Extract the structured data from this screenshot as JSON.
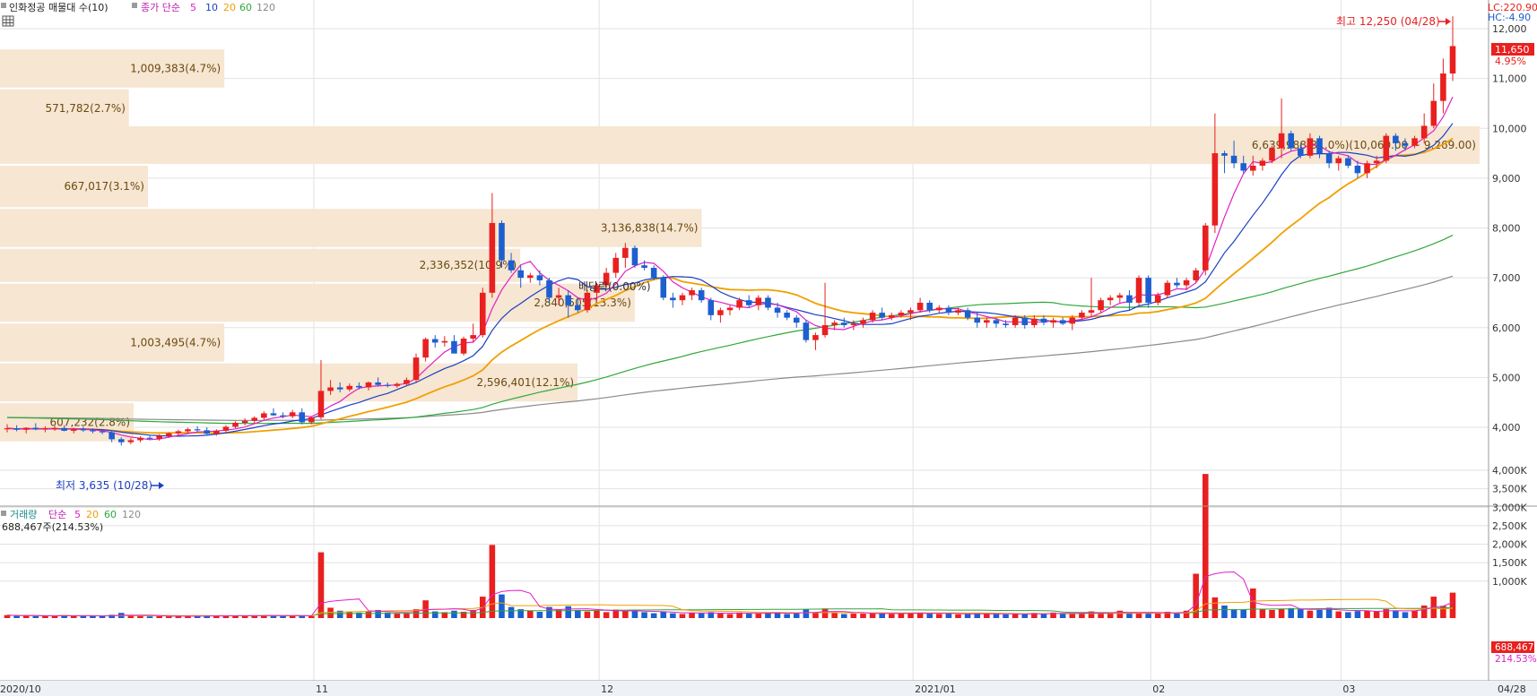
{
  "price_panel": {
    "legend": {
      "title": "인화정공 매물대 수(10)",
      "ma_label": "종가 단순",
      "ma_periods": [
        "5",
        "10",
        "20",
        "60",
        "120"
      ]
    },
    "lc_label": "LC:220.90",
    "hc_label": "HC:-4.90",
    "high_label": "최고 12,250 (04/28)",
    "low_label": "최저 3,635 (10/28)",
    "dividend_label": "배당락(0.00%)",
    "last_price": "11,650",
    "last_change": "4.95%",
    "y_ticks": [
      "12,000",
      "11,000",
      "10,000",
      "9,000",
      "8,000",
      "7,000",
      "6,000",
      "5,000",
      "4,000"
    ]
  },
  "volume_panel": {
    "legend": {
      "title": "거래량",
      "ma_label": "단순",
      "ma_periods": [
        "5",
        "20",
        "60",
        "120"
      ]
    },
    "info": "688,467주(214.53%)",
    "last_volume": "688,467",
    "last_ratio": "214.53%",
    "y_ticks": [
      "4,000K",
      "3,500K",
      "3,000K",
      "2,500K",
      "2,000K",
      "1,500K",
      "1,000K"
    ]
  },
  "x_labels": [
    "2020/10",
    "11",
    "12",
    "2021/01",
    "02",
    "03",
    "04",
    "04/28"
  ],
  "colors": {
    "up": "#e8201f",
    "down": "#1c5fcf",
    "ma5": "#e020c8",
    "ma10": "#1a3fc4",
    "ma20": "#f0a000",
    "ma60": "#2fa83a",
    "ma120": "#8a8a8a",
    "volume_profile": "#f6e6d2",
    "grid": "#e2e2e2"
  },
  "chart_data": {
    "type": "candlestick",
    "title": "인화정공 매물대 수(10)",
    "ylim": [
      3500,
      12400
    ],
    "volume_profile": [
      {
        "label": "1,009,383(4.7%)",
        "low": 10800,
        "high": 11600,
        "share_pct": 4.7
      },
      {
        "label": "571,782(2.7%)",
        "low": 10000,
        "high": 10800,
        "share_pct": 2.7
      },
      {
        "label": "6,639,988(31.0%)(10,060.00 ~ 9,269.00)",
        "low": 9269,
        "high": 10060,
        "share_pct": 31.0
      },
      {
        "label": "667,017(3.1%)",
        "low": 8400,
        "high": 9269,
        "share_pct": 3.1
      },
      {
        "label": "3,136,838(14.7%)",
        "low": 7600,
        "high": 8400,
        "share_pct": 14.7
      },
      {
        "label": "2,336,352(10.9%)",
        "low": 6900,
        "high": 7600,
        "share_pct": 10.9
      },
      {
        "label": "2,840,505(13.3%)",
        "low": 6100,
        "high": 6900,
        "share_pct": 13.3
      },
      {
        "label": "1,003,495(4.7%)",
        "low": 5300,
        "high": 6100,
        "share_pct": 4.7
      },
      {
        "label": "2,596,401(12.1%)",
        "low": 4500,
        "high": 5300,
        "share_pct": 12.1
      },
      {
        "label": "607,232(2.8%)",
        "low": 3700,
        "high": 4500,
        "share_pct": 2.8
      }
    ],
    "candles": [
      {
        "o": 3970,
        "h": 4060,
        "l": 3900,
        "c": 3980
      },
      {
        "o": 3980,
        "h": 4040,
        "l": 3920,
        "c": 3950
      },
      {
        "o": 3950,
        "h": 4000,
        "l": 3880,
        "c": 3990
      },
      {
        "o": 3990,
        "h": 4080,
        "l": 3940,
        "c": 3960
      },
      {
        "o": 3960,
        "h": 4020,
        "l": 3900,
        "c": 3975
      },
      {
        "o": 3975,
        "h": 4030,
        "l": 3930,
        "c": 3985
      },
      {
        "o": 3985,
        "h": 4040,
        "l": 3920,
        "c": 3930
      },
      {
        "o": 3930,
        "h": 3990,
        "l": 3880,
        "c": 3960
      },
      {
        "o": 3960,
        "h": 4010,
        "l": 3910,
        "c": 3940
      },
      {
        "o": 3940,
        "h": 3980,
        "l": 3880,
        "c": 3920
      },
      {
        "o": 3920,
        "h": 3960,
        "l": 3860,
        "c": 3900
      },
      {
        "o": 3900,
        "h": 3940,
        "l": 3700,
        "c": 3760
      },
      {
        "o": 3760,
        "h": 3800,
        "l": 3635,
        "c": 3700
      },
      {
        "o": 3700,
        "h": 3780,
        "l": 3660,
        "c": 3740
      },
      {
        "o": 3740,
        "h": 3820,
        "l": 3700,
        "c": 3790
      },
      {
        "o": 3790,
        "h": 3850,
        "l": 3740,
        "c": 3770
      },
      {
        "o": 3770,
        "h": 3860,
        "l": 3730,
        "c": 3830
      },
      {
        "o": 3830,
        "h": 3900,
        "l": 3790,
        "c": 3880
      },
      {
        "o": 3880,
        "h": 3950,
        "l": 3840,
        "c": 3920
      },
      {
        "o": 3920,
        "h": 3990,
        "l": 3880,
        "c": 3960
      },
      {
        "o": 3960,
        "h": 4020,
        "l": 3900,
        "c": 3940
      },
      {
        "o": 3940,
        "h": 4000,
        "l": 3840,
        "c": 3870
      },
      {
        "o": 3870,
        "h": 3960,
        "l": 3830,
        "c": 3930
      },
      {
        "o": 3930,
        "h": 4040,
        "l": 3900,
        "c": 4010
      },
      {
        "o": 4010,
        "h": 4120,
        "l": 3980,
        "c": 4090
      },
      {
        "o": 4090,
        "h": 4180,
        "l": 4040,
        "c": 4130
      },
      {
        "o": 4130,
        "h": 4220,
        "l": 4080,
        "c": 4190
      },
      {
        "o": 4190,
        "h": 4320,
        "l": 4150,
        "c": 4280
      },
      {
        "o": 4280,
        "h": 4380,
        "l": 4230,
        "c": 4240
      },
      {
        "o": 4240,
        "h": 4300,
        "l": 4180,
        "c": 4220
      },
      {
        "o": 4220,
        "h": 4350,
        "l": 4180,
        "c": 4300
      },
      {
        "o": 4300,
        "h": 4380,
        "l": 4060,
        "c": 4100
      },
      {
        "o": 4100,
        "h": 4220,
        "l": 4060,
        "c": 4200
      },
      {
        "o": 4200,
        "h": 5350,
        "l": 4160,
        "c": 4730
      },
      {
        "o": 4730,
        "h": 4950,
        "l": 4650,
        "c": 4800
      },
      {
        "o": 4800,
        "h": 4900,
        "l": 4700,
        "c": 4760
      },
      {
        "o": 4760,
        "h": 4880,
        "l": 4720,
        "c": 4830
      },
      {
        "o": 4830,
        "h": 4900,
        "l": 4760,
        "c": 4800
      },
      {
        "o": 4800,
        "h": 4920,
        "l": 4740,
        "c": 4900
      },
      {
        "o": 4900,
        "h": 5000,
        "l": 4820,
        "c": 4850
      },
      {
        "o": 4850,
        "h": 4900,
        "l": 4800,
        "c": 4830
      },
      {
        "o": 4830,
        "h": 4900,
        "l": 4790,
        "c": 4870
      },
      {
        "o": 4870,
        "h": 5000,
        "l": 4830,
        "c": 4950
      },
      {
        "o": 4950,
        "h": 5480,
        "l": 4900,
        "c": 5400
      },
      {
        "o": 5400,
        "h": 5800,
        "l": 5320,
        "c": 5770
      },
      {
        "o": 5770,
        "h": 5850,
        "l": 5600,
        "c": 5700
      },
      {
        "o": 5700,
        "h": 5830,
        "l": 5620,
        "c": 5730
      },
      {
        "o": 5730,
        "h": 5850,
        "l": 5600,
        "c": 5480
      },
      {
        "o": 5480,
        "h": 5820,
        "l": 5440,
        "c": 5780
      },
      {
        "o": 5780,
        "h": 6080,
        "l": 5700,
        "c": 5850
      },
      {
        "o": 5850,
        "h": 6800,
        "l": 5800,
        "c": 6700
      },
      {
        "o": 6700,
        "h": 8700,
        "l": 6600,
        "c": 8100
      },
      {
        "o": 8100,
        "h": 8150,
        "l": 7200,
        "c": 7350
      },
      {
        "o": 7350,
        "h": 7500,
        "l": 7100,
        "c": 7150
      },
      {
        "o": 7150,
        "h": 7250,
        "l": 6800,
        "c": 7000
      },
      {
        "o": 7000,
        "h": 7100,
        "l": 6900,
        "c": 7050
      },
      {
        "o": 7050,
        "h": 7150,
        "l": 6850,
        "c": 6950
      },
      {
        "o": 6950,
        "h": 7000,
        "l": 6500,
        "c": 6600
      },
      {
        "o": 6600,
        "h": 6800,
        "l": 6450,
        "c": 6650
      },
      {
        "o": 6650,
        "h": 6750,
        "l": 6200,
        "c": 6450
      },
      {
        "o": 6450,
        "h": 6600,
        "l": 6300,
        "c": 6350
      },
      {
        "o": 6350,
        "h": 6750,
        "l": 6300,
        "c": 6700
      },
      {
        "o": 6700,
        "h": 6900,
        "l": 6550,
        "c": 6850
      },
      {
        "o": 6850,
        "h": 7200,
        "l": 6800,
        "c": 7100
      },
      {
        "o": 7100,
        "h": 7500,
        "l": 7000,
        "c": 7400
      },
      {
        "o": 7400,
        "h": 7700,
        "l": 7200,
        "c": 7600
      },
      {
        "o": 7600,
        "h": 7650,
        "l": 7200,
        "c": 7250
      },
      {
        "o": 7250,
        "h": 7350,
        "l": 7150,
        "c": 7200
      },
      {
        "o": 7200,
        "h": 7250,
        "l": 6950,
        "c": 7000
      },
      {
        "o": 7000,
        "h": 7050,
        "l": 6550,
        "c": 6600
      },
      {
        "o": 6600,
        "h": 6700,
        "l": 6400,
        "c": 6550
      },
      {
        "o": 6550,
        "h": 6700,
        "l": 6450,
        "c": 6650
      },
      {
        "o": 6650,
        "h": 6800,
        "l": 6550,
        "c": 6750
      },
      {
        "o": 6750,
        "h": 6800,
        "l": 6500,
        "c": 6550
      },
      {
        "o": 6550,
        "h": 6600,
        "l": 6150,
        "c": 6250
      },
      {
        "o": 6250,
        "h": 6400,
        "l": 6100,
        "c": 6350
      },
      {
        "o": 6350,
        "h": 6450,
        "l": 6250,
        "c": 6400
      },
      {
        "o": 6400,
        "h": 6600,
        "l": 6350,
        "c": 6550
      },
      {
        "o": 6550,
        "h": 6650,
        "l": 6400,
        "c": 6450
      },
      {
        "o": 6450,
        "h": 6650,
        "l": 6350,
        "c": 6600
      },
      {
        "o": 6600,
        "h": 6650,
        "l": 6350,
        "c": 6400
      },
      {
        "o": 6400,
        "h": 6500,
        "l": 6200,
        "c": 6300
      },
      {
        "o": 6300,
        "h": 6350,
        "l": 6150,
        "c": 6200
      },
      {
        "o": 6200,
        "h": 6250,
        "l": 6000,
        "c": 6100
      },
      {
        "o": 6100,
        "h": 6150,
        "l": 5700,
        "c": 5750
      },
      {
        "o": 5750,
        "h": 5900,
        "l": 5550,
        "c": 5850
      },
      {
        "o": 5850,
        "h": 6900,
        "l": 5800,
        "c": 6050
      },
      {
        "o": 6050,
        "h": 6150,
        "l": 5950,
        "c": 6100
      },
      {
        "o": 6100,
        "h": 6200,
        "l": 6000,
        "c": 6050
      },
      {
        "o": 6050,
        "h": 6150,
        "l": 5950,
        "c": 6080
      },
      {
        "o": 6080,
        "h": 6200,
        "l": 6000,
        "c": 6150
      },
      {
        "o": 6150,
        "h": 6350,
        "l": 6100,
        "c": 6300
      },
      {
        "o": 6300,
        "h": 6400,
        "l": 6150,
        "c": 6200
      },
      {
        "o": 6200,
        "h": 6300,
        "l": 6150,
        "c": 6250
      },
      {
        "o": 6250,
        "h": 6350,
        "l": 6200,
        "c": 6300
      },
      {
        "o": 6300,
        "h": 6400,
        "l": 6150,
        "c": 6350
      },
      {
        "o": 6350,
        "h": 6600,
        "l": 6300,
        "c": 6500
      },
      {
        "o": 6500,
        "h": 6550,
        "l": 6300,
        "c": 6350
      },
      {
        "o": 6350,
        "h": 6450,
        "l": 6300,
        "c": 6400
      },
      {
        "o": 6400,
        "h": 6450,
        "l": 6250,
        "c": 6300
      },
      {
        "o": 6300,
        "h": 6400,
        "l": 6250,
        "c": 6350
      },
      {
        "o": 6350,
        "h": 6400,
        "l": 6150,
        "c": 6200
      },
      {
        "o": 6200,
        "h": 6300,
        "l": 6000,
        "c": 6100
      },
      {
        "o": 6100,
        "h": 6200,
        "l": 6000,
        "c": 6150
      },
      {
        "o": 6150,
        "h": 6200,
        "l": 6000,
        "c": 6080
      },
      {
        "o": 6080,
        "h": 6150,
        "l": 6000,
        "c": 6050
      },
      {
        "o": 6050,
        "h": 6250,
        "l": 6000,
        "c": 6200
      },
      {
        "o": 6200,
        "h": 6250,
        "l": 5980,
        "c": 6050
      },
      {
        "o": 6050,
        "h": 6250,
        "l": 6000,
        "c": 6180
      },
      {
        "o": 6180,
        "h": 6250,
        "l": 6050,
        "c": 6100
      },
      {
        "o": 6100,
        "h": 6200,
        "l": 6000,
        "c": 6150
      },
      {
        "o": 6150,
        "h": 6200,
        "l": 6050,
        "c": 6080
      },
      {
        "o": 6080,
        "h": 6250,
        "l": 5950,
        "c": 6200
      },
      {
        "o": 6200,
        "h": 6350,
        "l": 6150,
        "c": 6300
      },
      {
        "o": 6300,
        "h": 7000,
        "l": 6200,
        "c": 6350
      },
      {
        "o": 6350,
        "h": 6600,
        "l": 6300,
        "c": 6550
      },
      {
        "o": 6550,
        "h": 6650,
        "l": 6450,
        "c": 6600
      },
      {
        "o": 6600,
        "h": 6700,
        "l": 6500,
        "c": 6650
      },
      {
        "o": 6650,
        "h": 6750,
        "l": 6350,
        "c": 6500
      },
      {
        "o": 6500,
        "h": 7050,
        "l": 6450,
        "c": 7000
      },
      {
        "o": 7000,
        "h": 7050,
        "l": 6400,
        "c": 6500
      },
      {
        "o": 6500,
        "h": 6700,
        "l": 6450,
        "c": 6650
      },
      {
        "o": 6650,
        "h": 6950,
        "l": 6600,
        "c": 6900
      },
      {
        "o": 6900,
        "h": 7000,
        "l": 6800,
        "c": 6850
      },
      {
        "o": 6850,
        "h": 7000,
        "l": 6750,
        "c": 6950
      },
      {
        "o": 6950,
        "h": 7200,
        "l": 6900,
        "c": 7150
      },
      {
        "o": 7150,
        "h": 8100,
        "l": 7050,
        "c": 8050
      },
      {
        "o": 8050,
        "h": 10300,
        "l": 7900,
        "c": 9500
      },
      {
        "o": 9500,
        "h": 9550,
        "l": 9100,
        "c": 9450
      },
      {
        "o": 9450,
        "h": 9750,
        "l": 9200,
        "c": 9300
      },
      {
        "o": 9300,
        "h": 9450,
        "l": 9100,
        "c": 9150
      },
      {
        "o": 9150,
        "h": 9450,
        "l": 9050,
        "c": 9250
      },
      {
        "o": 9250,
        "h": 9400,
        "l": 9150,
        "c": 9350
      },
      {
        "o": 9350,
        "h": 9650,
        "l": 9300,
        "c": 9600
      },
      {
        "o": 9600,
        "h": 10600,
        "l": 9400,
        "c": 9900
      },
      {
        "o": 9900,
        "h": 9950,
        "l": 9550,
        "c": 9600
      },
      {
        "o": 9600,
        "h": 9700,
        "l": 9400,
        "c": 9450
      },
      {
        "o": 9450,
        "h": 9900,
        "l": 9400,
        "c": 9800
      },
      {
        "o": 9800,
        "h": 9850,
        "l": 9400,
        "c": 9500
      },
      {
        "o": 9500,
        "h": 9550,
        "l": 9200,
        "c": 9300
      },
      {
        "o": 9300,
        "h": 9450,
        "l": 9150,
        "c": 9400
      },
      {
        "o": 9400,
        "h": 9450,
        "l": 9200,
        "c": 9250
      },
      {
        "o": 9250,
        "h": 9350,
        "l": 9000,
        "c": 9100
      },
      {
        "o": 9100,
        "h": 9350,
        "l": 9000,
        "c": 9300
      },
      {
        "o": 9300,
        "h": 9450,
        "l": 9200,
        "c": 9350
      },
      {
        "o": 9350,
        "h": 9900,
        "l": 9300,
        "c": 9850
      },
      {
        "o": 9850,
        "h": 9900,
        "l": 9550,
        "c": 9700
      },
      {
        "o": 9700,
        "h": 9800,
        "l": 9550,
        "c": 9650
      },
      {
        "o": 9650,
        "h": 9850,
        "l": 9600,
        "c": 9800
      },
      {
        "o": 9800,
        "h": 10300,
        "l": 9700,
        "c": 10050
      },
      {
        "o": 10050,
        "h": 10900,
        "l": 10000,
        "c": 10550
      },
      {
        "o": 10550,
        "h": 11400,
        "l": 10300,
        "c": 11100
      },
      {
        "o": 11100,
        "h": 12250,
        "l": 10950,
        "c": 11650
      }
    ],
    "volume_k": [
      80,
      60,
      70,
      50,
      60,
      55,
      75,
      60,
      65,
      50,
      55,
      90,
      140,
      60,
      55,
      45,
      50,
      45,
      55,
      60,
      50,
      65,
      60,
      55,
      70,
      60,
      75,
      80,
      65,
      55,
      60,
      75,
      55,
      1780,
      280,
      200,
      170,
      150,
      180,
      220,
      150,
      130,
      140,
      240,
      480,
      180,
      160,
      200,
      170,
      220,
      580,
      1980,
      640,
      300,
      240,
      200,
      170,
      300,
      240,
      320,
      220,
      180,
      200,
      160,
      230,
      190,
      200,
      160,
      130,
      180,
      130,
      110,
      150,
      130,
      160,
      120,
      110,
      150,
      120,
      130,
      140,
      160,
      110,
      120,
      230,
      150,
      260,
      140,
      110,
      120,
      120,
      130,
      140,
      110,
      120,
      130,
      150,
      120,
      110,
      120,
      100,
      110,
      130,
      110,
      120,
      100,
      110,
      100,
      140,
      120,
      150,
      120,
      110,
      140,
      180,
      120,
      150,
      200,
      130,
      160,
      140,
      120,
      170,
      140,
      200,
      1200,
      3900,
      560,
      340,
      240,
      230,
      800,
      240,
      220,
      250,
      270,
      240,
      200,
      220,
      280,
      180,
      160,
      190,
      200,
      180,
      240,
      200,
      160,
      200,
      340,
      580,
      330,
      688
    ],
    "ma_stats": {
      "last_volume_ratio_pct": 214.53
    }
  }
}
